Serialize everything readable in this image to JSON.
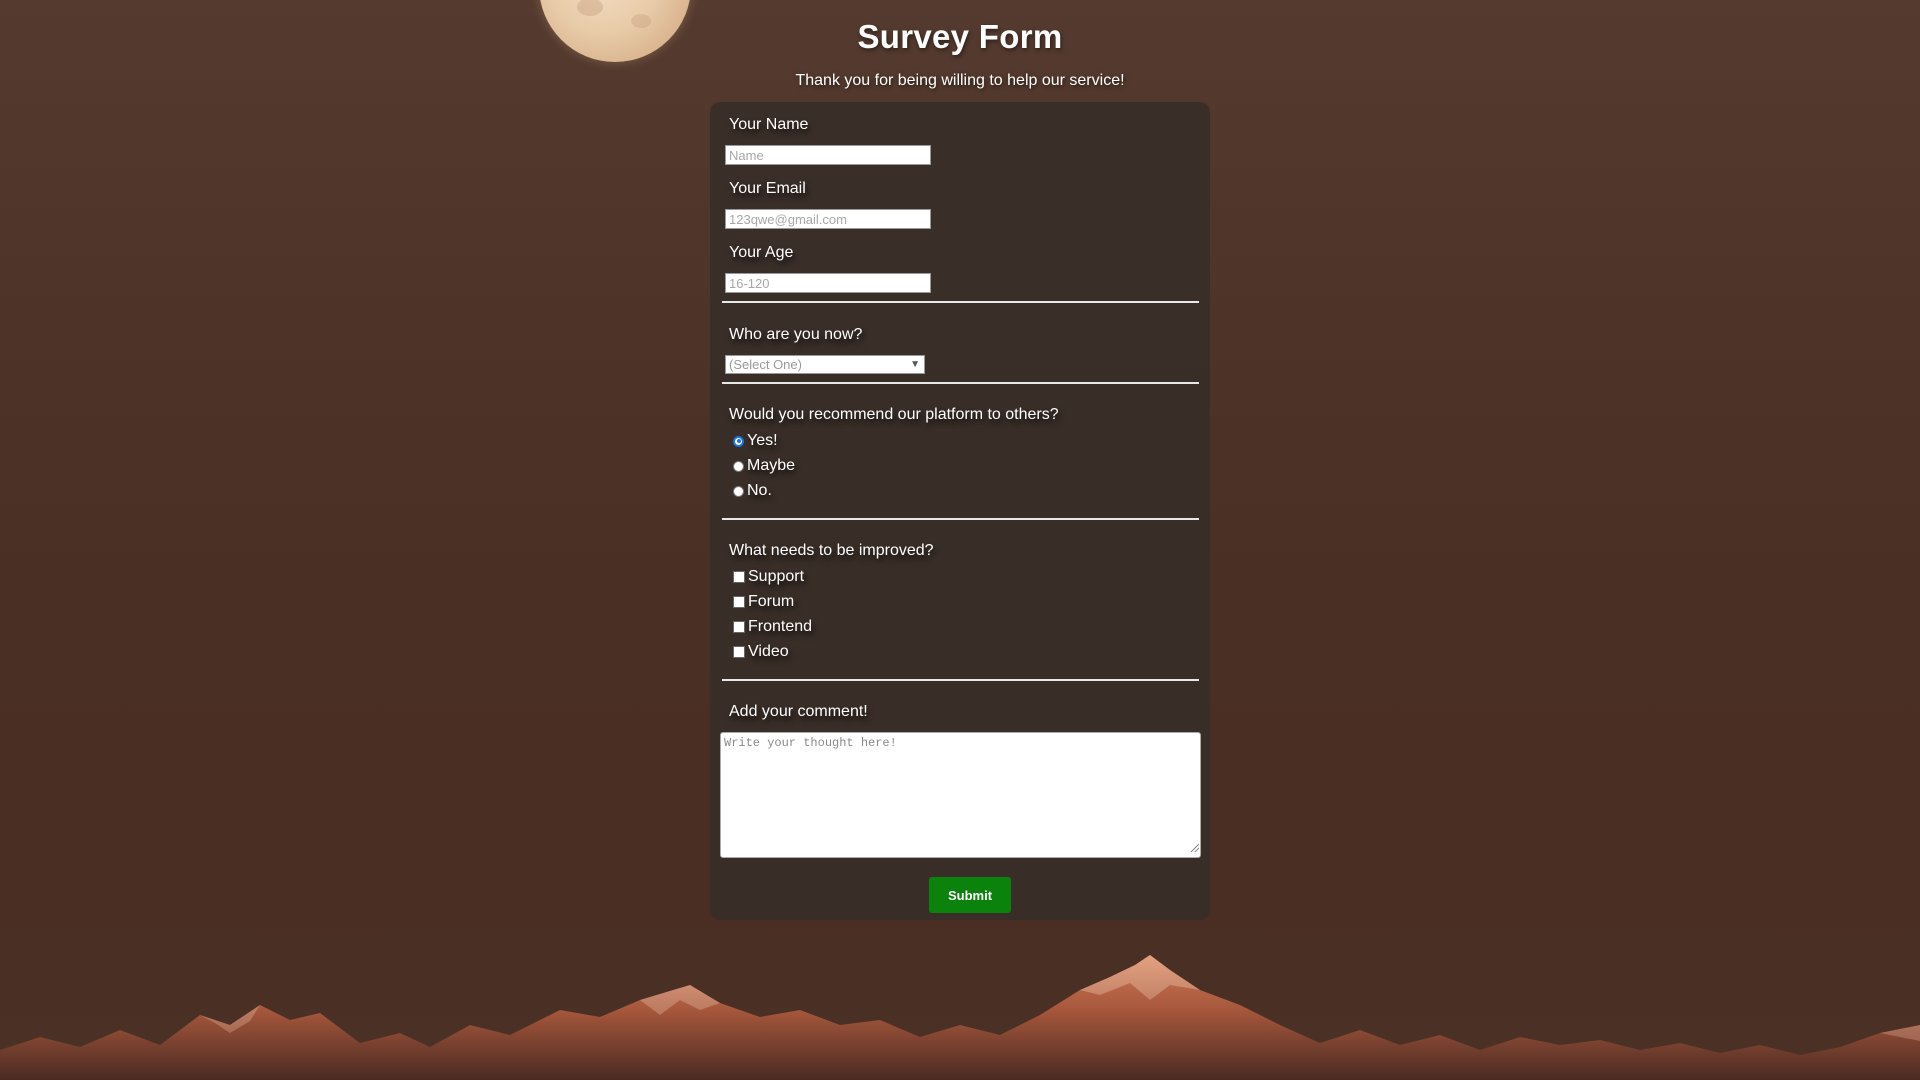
{
  "page": {
    "title": "Survey Form",
    "subtitle": "Thank you for being willing to help our service!"
  },
  "form": {
    "name": {
      "label": "Your Name",
      "placeholder": "Name",
      "value": ""
    },
    "email": {
      "label": "Your Email",
      "placeholder": "123qwe@gmail.com",
      "value": ""
    },
    "age": {
      "label": "Your Age",
      "placeholder": "16-120",
      "value": ""
    },
    "role": {
      "label": "Who are you now?",
      "selected": "(Select One)"
    },
    "recommend": {
      "label": "Would you recommend our platform to others?",
      "options": [
        {
          "label": "Yes!",
          "checked": true
        },
        {
          "label": "Maybe",
          "checked": false
        },
        {
          "label": "No.",
          "checked": false
        }
      ]
    },
    "improve": {
      "label": "What needs to be improved?",
      "options": [
        {
          "label": "Support",
          "checked": false
        },
        {
          "label": "Forum",
          "checked": false
        },
        {
          "label": "Frontend",
          "checked": false
        },
        {
          "label": "Video",
          "checked": false
        }
      ]
    },
    "comment": {
      "label": "Add your comment!",
      "placeholder": "Write your thought here!",
      "value": ""
    },
    "submit_label": "Submit"
  },
  "colors": {
    "submit_bg": "#0b820b",
    "radio_accent": "#1a73e8"
  },
  "icons": {
    "select": "chevron-down-icon",
    "textarea": "resize-grip-icon"
  }
}
